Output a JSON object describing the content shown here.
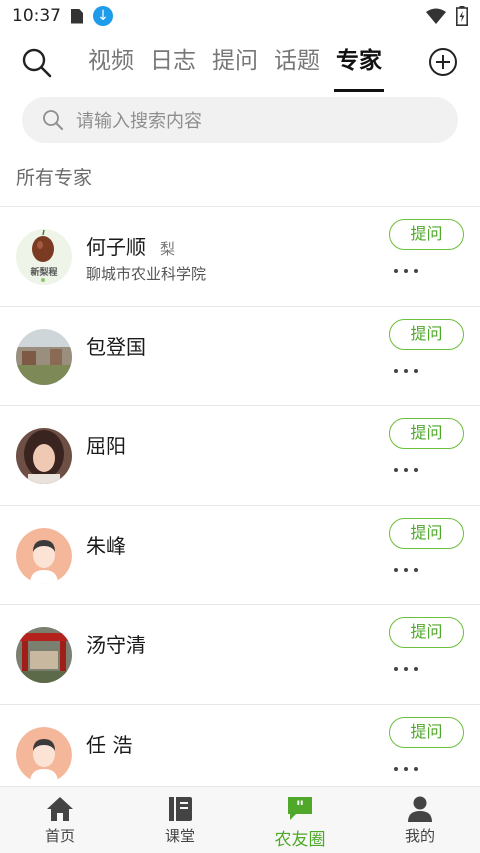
{
  "status_bar": {
    "time": "10:37"
  },
  "header": {
    "tabs": [
      {
        "label": "视频",
        "active": false
      },
      {
        "label": "日志",
        "active": false
      },
      {
        "label": "提问",
        "active": false
      },
      {
        "label": "话题",
        "active": false
      },
      {
        "label": "专家",
        "active": true
      }
    ]
  },
  "search": {
    "placeholder": "请输入搜索内容"
  },
  "section_title": "所有专家",
  "ask_label": "提问",
  "experts": [
    {
      "name": "何子顺",
      "tag": "梨",
      "org": "聊城市农业科学院",
      "avatar_logo": "新梨程"
    },
    {
      "name": "包登国",
      "tag": "",
      "org": ""
    },
    {
      "name": "屈阳",
      "tag": "",
      "org": ""
    },
    {
      "name": "朱峰",
      "tag": "",
      "org": ""
    },
    {
      "name": "汤守清",
      "tag": "",
      "org": ""
    },
    {
      "name": "任 浩",
      "tag": "",
      "org": ""
    }
  ],
  "bottom_nav": [
    {
      "label": "首页",
      "icon": "home-icon",
      "active": false
    },
    {
      "label": "课堂",
      "icon": "book-icon",
      "active": false
    },
    {
      "label": "农友圈",
      "icon": "chat-quote-icon",
      "active": true
    },
    {
      "label": "我的",
      "icon": "person-icon",
      "active": false
    }
  ],
  "colors": {
    "accent": "#4fa82a",
    "accent_border": "#6bbf3b",
    "download_badge": "#1e9be9"
  }
}
